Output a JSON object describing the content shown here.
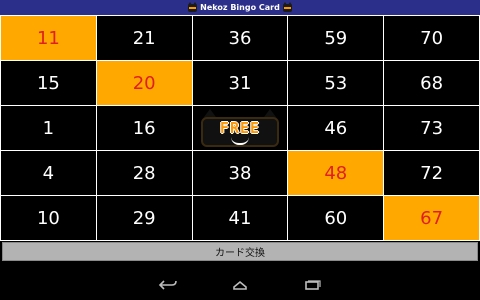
{
  "app": {
    "title": "Nekoz Bingo Card"
  },
  "bingo": {
    "rows": [
      [
        {
          "text": "11",
          "marked": true
        },
        {
          "text": "21",
          "marked": false
        },
        {
          "text": "36",
          "marked": false
        },
        {
          "text": "59",
          "marked": false
        },
        {
          "text": "70",
          "marked": false
        }
      ],
      [
        {
          "text": "15",
          "marked": false
        },
        {
          "text": "20",
          "marked": true
        },
        {
          "text": "31",
          "marked": false
        },
        {
          "text": "53",
          "marked": false
        },
        {
          "text": "68",
          "marked": false
        }
      ],
      [
        {
          "text": "1",
          "marked": false
        },
        {
          "text": "16",
          "marked": false
        },
        {
          "text": "FREE",
          "marked": false,
          "free": true
        },
        {
          "text": "46",
          "marked": false
        },
        {
          "text": "73",
          "marked": false
        }
      ],
      [
        {
          "text": "4",
          "marked": false
        },
        {
          "text": "28",
          "marked": false
        },
        {
          "text": "38",
          "marked": false
        },
        {
          "text": "48",
          "marked": true
        },
        {
          "text": "72",
          "marked": false
        }
      ],
      [
        {
          "text": "10",
          "marked": false
        },
        {
          "text": "29",
          "marked": false
        },
        {
          "text": "41",
          "marked": false
        },
        {
          "text": "60",
          "marked": false
        },
        {
          "text": "67",
          "marked": true
        }
      ]
    ]
  },
  "actions": {
    "change_card_label": "カード交換"
  },
  "nav": {
    "icons": [
      "back-icon",
      "home-icon",
      "recent-apps-icon"
    ]
  },
  "colors": {
    "titlebar": "#2b2f8a",
    "marked_bg": "#ffa800",
    "marked_text": "#e02020",
    "cell_bg": "#000000",
    "cell_text": "#ffffff"
  }
}
